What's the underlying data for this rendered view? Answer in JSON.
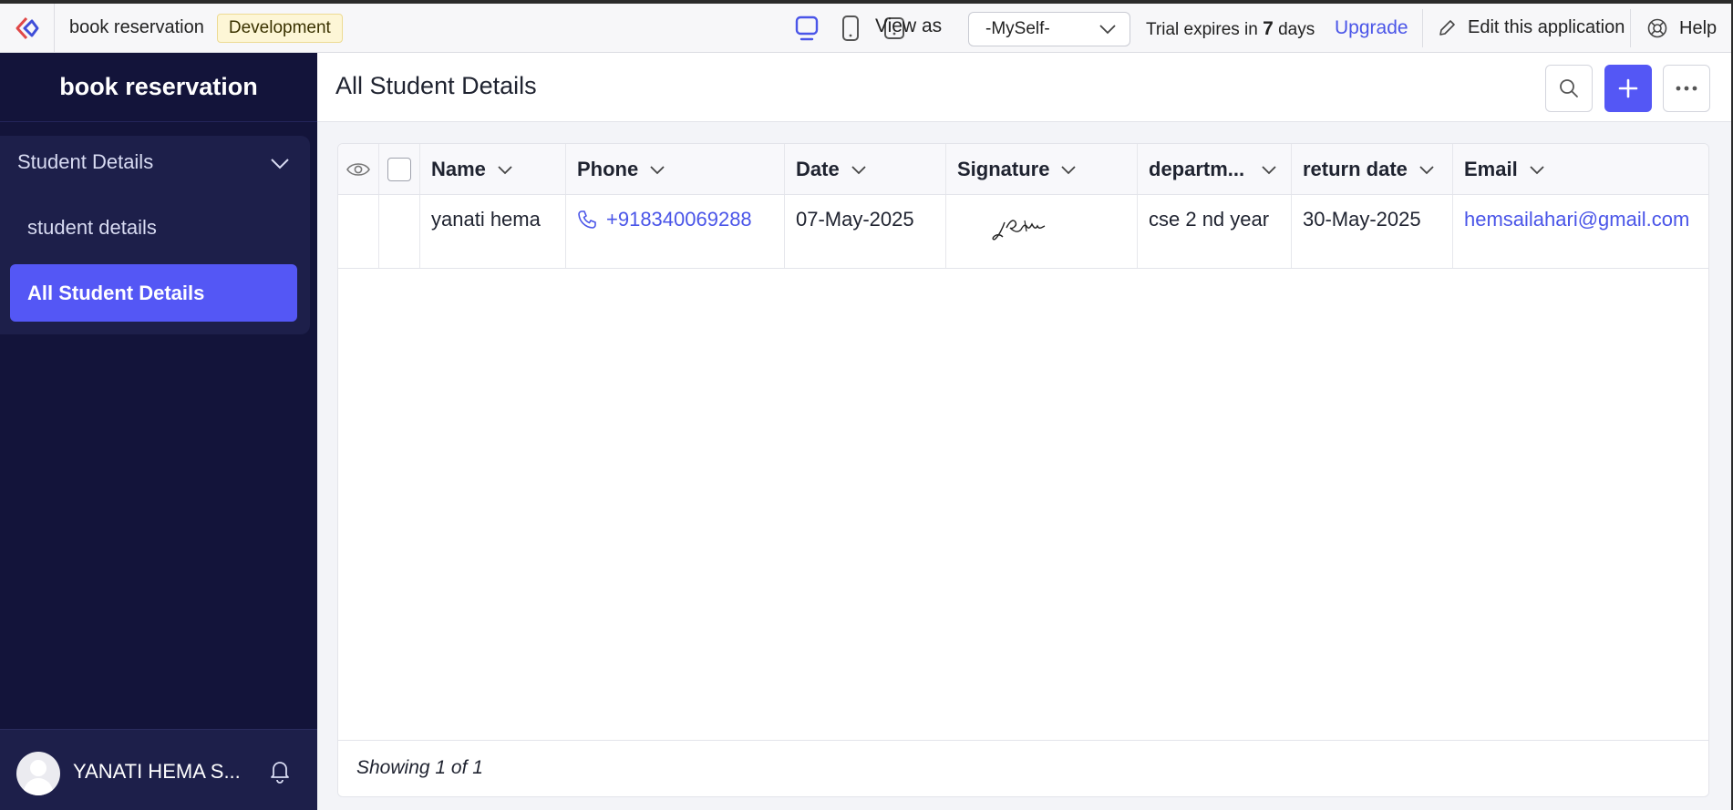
{
  "topbar": {
    "app_name": "book reservation",
    "env_badge": "Development",
    "view_as_label": "View as",
    "view_as_selected": "-MySelf-",
    "trial_prefix": "Trial expires in ",
    "trial_days": "7",
    "trial_suffix": " days",
    "upgrade_label": "Upgrade",
    "edit_label": "Edit this application",
    "help_label": "Help"
  },
  "sidebar": {
    "title": "book reservation",
    "group_label": "Student Details",
    "items": [
      {
        "label": "student details"
      },
      {
        "label": "All Student Details"
      }
    ],
    "user_name": "YANATI HEMA S..."
  },
  "main": {
    "page_title": "All Student Details",
    "columns": [
      "Name",
      "Phone",
      "Date",
      "Signature",
      "departm...",
      "return date",
      "Email"
    ],
    "rows": [
      {
        "name": "yanati hema",
        "phone": "+918340069288",
        "date": "07-May-2025",
        "department": "cse 2 nd year",
        "return_date": "30-May-2025",
        "email": "hemsailahari@gmail.com"
      }
    ],
    "footer": "Showing 1 of 1"
  },
  "colors": {
    "accent": "#5457f5",
    "sidebar_bg": "#13143a",
    "link": "#4a55e8"
  }
}
